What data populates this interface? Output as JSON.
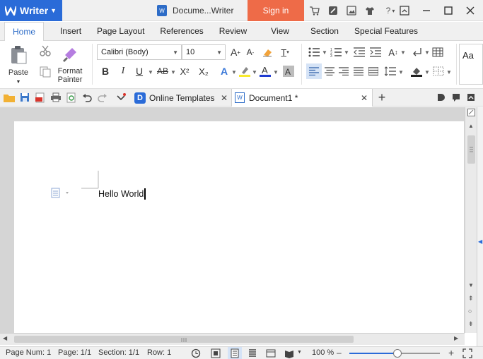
{
  "app": {
    "name": "Writer",
    "doc_title": "Docume...Writer",
    "sign_in": "Sign in"
  },
  "menu": {
    "tabs": [
      "Home",
      "Insert",
      "Page Layout",
      "References",
      "Review",
      "View",
      "Section",
      "Special Features"
    ]
  },
  "ribbon": {
    "paste": "Paste",
    "format_painter_1": "Format",
    "format_painter_2": "Painter",
    "font_name": "Calibri (Body)",
    "font_size": "10",
    "bold": "B",
    "italic": "I",
    "underline": "U",
    "strike": "AB",
    "superscript": "X²",
    "subscript": "X₂",
    "styles_preview": "Aa"
  },
  "doc_tabs": {
    "online_templates": "Online Templates",
    "document": "Document1 *"
  },
  "document": {
    "text": "Hello World"
  },
  "status": {
    "page_num": "Page Num: 1",
    "page": "Page: 1/1",
    "section": "Section: 1/1",
    "row": "Row: 1",
    "zoom": "100 %"
  },
  "colors": {
    "accent": "#2a6bd8",
    "signin": "#ee6b48"
  }
}
